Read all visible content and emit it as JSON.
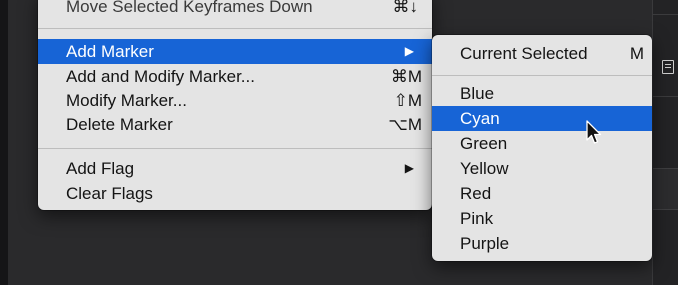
{
  "main_menu": {
    "items": [
      {
        "label": "Move Selected Keyframes Down",
        "shortcut": "⌘↓"
      },
      {
        "label": "Add Marker",
        "arrow": "▶"
      },
      {
        "label": "Add and Modify Marker...",
        "shortcut": "⌘M"
      },
      {
        "label": "Modify Marker...",
        "shortcut": "⇧M"
      },
      {
        "label": "Delete Marker",
        "shortcut": "⌥M"
      },
      {
        "label": "Add Flag",
        "arrow": "▶"
      },
      {
        "label": "Clear Flags"
      }
    ]
  },
  "marker_submenu": {
    "items": [
      {
        "label": "Current Selected",
        "shortcut": "M"
      },
      {
        "label": "Blue"
      },
      {
        "label": "Cyan"
      },
      {
        "label": "Green"
      },
      {
        "label": "Yellow"
      },
      {
        "label": "Red"
      },
      {
        "label": "Pink"
      },
      {
        "label": "Purple"
      }
    ]
  },
  "colors": {
    "highlight": "#1764d6",
    "menu_background": "#e4e4e4",
    "app_background": "#2a2a2c"
  },
  "icons": {
    "pointer": "arrow-cursor-icon",
    "side_panel": "panel-icon"
  }
}
